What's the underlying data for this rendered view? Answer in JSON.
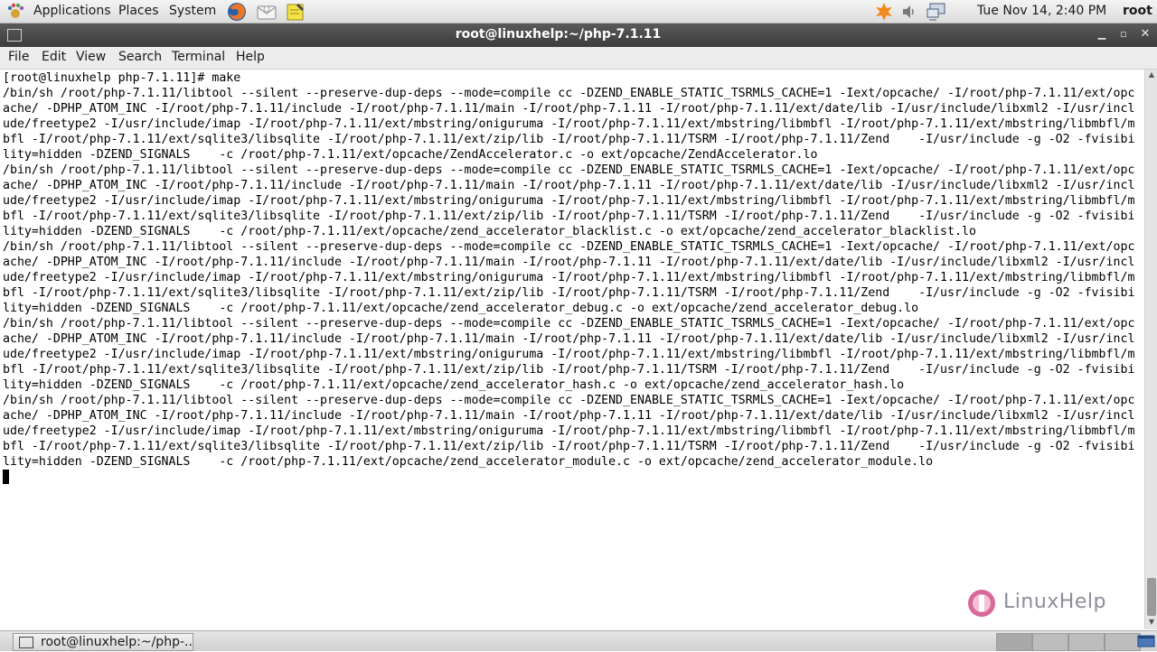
{
  "top_panel": {
    "menus": [
      "Applications",
      "Places",
      "System"
    ],
    "clock": "Tue Nov 14,  2:40 PM",
    "user": "root"
  },
  "window": {
    "title": "root@linuxhelp:~/php-7.1.11",
    "minimize": "▁",
    "maximize": "▫",
    "close": "✕"
  },
  "menubar": [
    "File",
    "Edit",
    "View",
    "Search",
    "Terminal",
    "Help"
  ],
  "terminal": {
    "lines": [
      "[root@linuxhelp php-7.1.11]# make",
      "/bin/sh /root/php-7.1.11/libtool --silent --preserve-dup-deps --mode=compile cc -DZEND_ENABLE_STATIC_TSRMLS_CACHE=1 -Iext/opcache/ -I/root/php-7.1.11/ext/opc",
      "ache/ -DPHP_ATOM_INC -I/root/php-7.1.11/include -I/root/php-7.1.11/main -I/root/php-7.1.11 -I/root/php-7.1.11/ext/date/lib -I/usr/include/libxml2 -I/usr/incl",
      "ude/freetype2 -I/usr/include/imap -I/root/php-7.1.11/ext/mbstring/oniguruma -I/root/php-7.1.11/ext/mbstring/libmbfl -I/root/php-7.1.11/ext/mbstring/libmbfl/m",
      "bfl -I/root/php-7.1.11/ext/sqlite3/libsqlite -I/root/php-7.1.11/ext/zip/lib -I/root/php-7.1.11/TSRM -I/root/php-7.1.11/Zend    -I/usr/include -g -O2 -fvisibi",
      "lity=hidden -DZEND_SIGNALS    -c /root/php-7.1.11/ext/opcache/ZendAccelerator.c -o ext/opcache/ZendAccelerator.lo",
      "/bin/sh /root/php-7.1.11/libtool --silent --preserve-dup-deps --mode=compile cc -DZEND_ENABLE_STATIC_TSRMLS_CACHE=1 -Iext/opcache/ -I/root/php-7.1.11/ext/opc",
      "ache/ -DPHP_ATOM_INC -I/root/php-7.1.11/include -I/root/php-7.1.11/main -I/root/php-7.1.11 -I/root/php-7.1.11/ext/date/lib -I/usr/include/libxml2 -I/usr/incl",
      "ude/freetype2 -I/usr/include/imap -I/root/php-7.1.11/ext/mbstring/oniguruma -I/root/php-7.1.11/ext/mbstring/libmbfl -I/root/php-7.1.11/ext/mbstring/libmbfl/m",
      "bfl -I/root/php-7.1.11/ext/sqlite3/libsqlite -I/root/php-7.1.11/ext/zip/lib -I/root/php-7.1.11/TSRM -I/root/php-7.1.11/Zend    -I/usr/include -g -O2 -fvisibi",
      "lity=hidden -DZEND_SIGNALS    -c /root/php-7.1.11/ext/opcache/zend_accelerator_blacklist.c -o ext/opcache/zend_accelerator_blacklist.lo",
      "/bin/sh /root/php-7.1.11/libtool --silent --preserve-dup-deps --mode=compile cc -DZEND_ENABLE_STATIC_TSRMLS_CACHE=1 -Iext/opcache/ -I/root/php-7.1.11/ext/opc",
      "ache/ -DPHP_ATOM_INC -I/root/php-7.1.11/include -I/root/php-7.1.11/main -I/root/php-7.1.11 -I/root/php-7.1.11/ext/date/lib -I/usr/include/libxml2 -I/usr/incl",
      "ude/freetype2 -I/usr/include/imap -I/root/php-7.1.11/ext/mbstring/oniguruma -I/root/php-7.1.11/ext/mbstring/libmbfl -I/root/php-7.1.11/ext/mbstring/libmbfl/m",
      "bfl -I/root/php-7.1.11/ext/sqlite3/libsqlite -I/root/php-7.1.11/ext/zip/lib -I/root/php-7.1.11/TSRM -I/root/php-7.1.11/Zend    -I/usr/include -g -O2 -fvisibi",
      "lity=hidden -DZEND_SIGNALS    -c /root/php-7.1.11/ext/opcache/zend_accelerator_debug.c -o ext/opcache/zend_accelerator_debug.lo",
      "/bin/sh /root/php-7.1.11/libtool --silent --preserve-dup-deps --mode=compile cc -DZEND_ENABLE_STATIC_TSRMLS_CACHE=1 -Iext/opcache/ -I/root/php-7.1.11/ext/opc",
      "ache/ -DPHP_ATOM_INC -I/root/php-7.1.11/include -I/root/php-7.1.11/main -I/root/php-7.1.11 -I/root/php-7.1.11/ext/date/lib -I/usr/include/libxml2 -I/usr/incl",
      "ude/freetype2 -I/usr/include/imap -I/root/php-7.1.11/ext/mbstring/oniguruma -I/root/php-7.1.11/ext/mbstring/libmbfl -I/root/php-7.1.11/ext/mbstring/libmbfl/m",
      "bfl -I/root/php-7.1.11/ext/sqlite3/libsqlite -I/root/php-7.1.11/ext/zip/lib -I/root/php-7.1.11/TSRM -I/root/php-7.1.11/Zend    -I/usr/include -g -O2 -fvisibi",
      "lity=hidden -DZEND_SIGNALS    -c /root/php-7.1.11/ext/opcache/zend_accelerator_hash.c -o ext/opcache/zend_accelerator_hash.lo",
      "/bin/sh /root/php-7.1.11/libtool --silent --preserve-dup-deps --mode=compile cc -DZEND_ENABLE_STATIC_TSRMLS_CACHE=1 -Iext/opcache/ -I/root/php-7.1.11/ext/opc",
      "ache/ -DPHP_ATOM_INC -I/root/php-7.1.11/include -I/root/php-7.1.11/main -I/root/php-7.1.11 -I/root/php-7.1.11/ext/date/lib -I/usr/include/libxml2 -I/usr/incl",
      "ude/freetype2 -I/usr/include/imap -I/root/php-7.1.11/ext/mbstring/oniguruma -I/root/php-7.1.11/ext/mbstring/libmbfl -I/root/php-7.1.11/ext/mbstring/libmbfl/m",
      "bfl -I/root/php-7.1.11/ext/sqlite3/libsqlite -I/root/php-7.1.11/ext/zip/lib -I/root/php-7.1.11/TSRM -I/root/php-7.1.11/Zend    -I/usr/include -g -O2 -fvisibi",
      "lity=hidden -DZEND_SIGNALS    -c /root/php-7.1.11/ext/opcache/zend_accelerator_module.c -o ext/opcache/zend_accelerator_module.lo"
    ]
  },
  "watermark": {
    "text": "LinuxHelp"
  },
  "taskbar": {
    "task_label": "root@linuxhelp:~/php-..."
  },
  "colors": {
    "panel": "#dcdcdc",
    "titlebar": "#3c3c3c",
    "terminal_bg": "#ffffff",
    "terminal_fg": "#000000",
    "watermark_accent": "#d9679a"
  },
  "icons": [
    "applications-foot-icon",
    "firefox-icon",
    "mail-icon",
    "notes-icon",
    "update-icon",
    "volume-icon",
    "network-icon",
    "terminal-icon",
    "show-desktop-icon"
  ]
}
